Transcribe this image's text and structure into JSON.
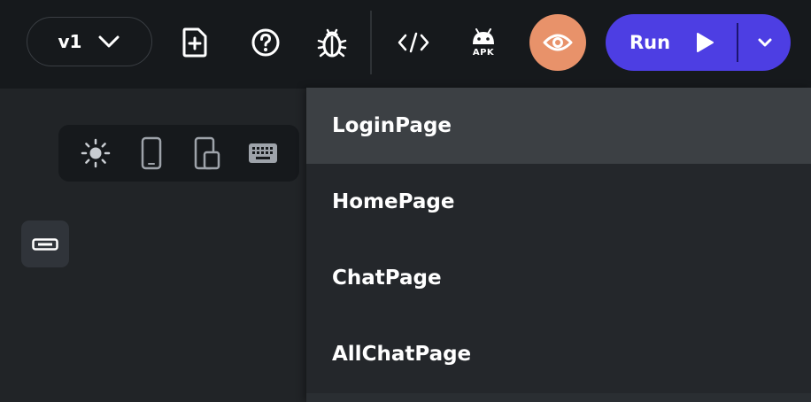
{
  "toolbar": {
    "version_label": "v1",
    "apk_label": "APK",
    "run_label": "Run",
    "icons": [
      "add-page-icon",
      "help-icon",
      "bug-icon",
      "code-icon",
      "android-apk-icon",
      "eye-icon",
      "play-icon",
      "chevron-down-icon"
    ]
  },
  "device_toolbar": {
    "icons": [
      "sun-icon",
      "phone-icon",
      "tablet-icon",
      "keyboard-icon"
    ]
  },
  "sidebar": {
    "icons": [
      "component-icon"
    ]
  },
  "page_menu": {
    "items": [
      {
        "label": "LoginPage"
      },
      {
        "label": "HomePage"
      },
      {
        "label": "ChatPage"
      },
      {
        "label": "AllChatPage"
      }
    ],
    "selected": "LoginPage"
  },
  "colors": {
    "background": "#212427",
    "topbar": "#16191c",
    "run_button": "#4d3ee3",
    "preview_button": "#e8926a",
    "menu_selected": "#3c4044"
  }
}
